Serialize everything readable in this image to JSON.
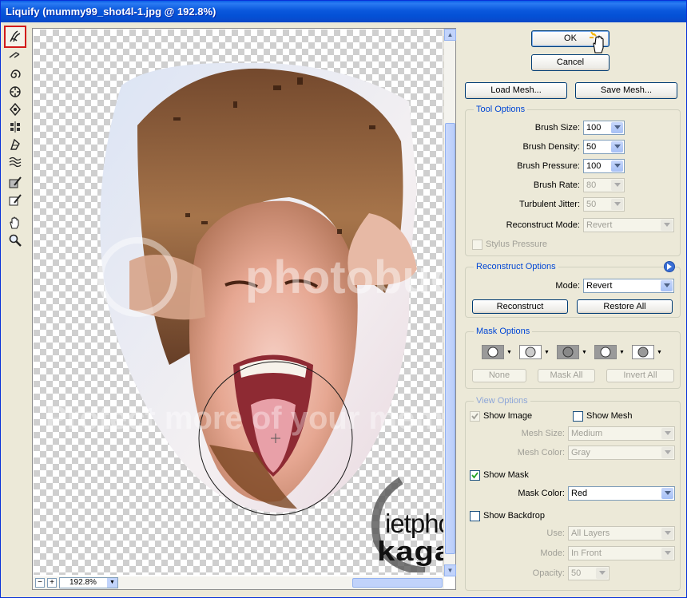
{
  "window": {
    "title": "Liquify (mummy99_shot4l-1.jpg @ 192.8%)"
  },
  "toolbar": {
    "tools": [
      {
        "name": "forward-warp-tool",
        "selected": true
      },
      {
        "name": "reconstruct-tool"
      },
      {
        "name": "twirl-clockwise-tool"
      },
      {
        "name": "pucker-tool"
      },
      {
        "name": "bloat-tool"
      },
      {
        "name": "push-left-tool"
      },
      {
        "name": "mirror-tool"
      },
      {
        "name": "turbulence-tool"
      },
      {
        "name": "freeze-mask-tool"
      },
      {
        "name": "thaw-mask-tool"
      },
      {
        "name": "hand-tool"
      },
      {
        "name": "zoom-tool"
      }
    ]
  },
  "canvas": {
    "zoom": "192.8%",
    "zoom_minus": "−",
    "zoom_plus": "+",
    "watermark_logo": "ietphotoshop",
    "watermark_logo_sub": "kagaya"
  },
  "buttons": {
    "ok": "OK",
    "cancel": "Cancel",
    "load_mesh": "Load Mesh...",
    "save_mesh": "Save Mesh..."
  },
  "tool_options": {
    "label": "Tool Options",
    "brush_size_label": "Brush Size:",
    "brush_size": "100",
    "brush_density_label": "Brush Density:",
    "brush_density": "50",
    "brush_pressure_label": "Brush Pressure:",
    "brush_pressure": "100",
    "brush_rate_label": "Brush Rate:",
    "brush_rate": "80",
    "turbulent_jitter_label": "Turbulent Jitter:",
    "turbulent_jitter": "50",
    "reconstruct_mode_label": "Reconstruct Mode:",
    "reconstruct_mode": "Revert",
    "stylus_pressure_label": "Stylus Pressure"
  },
  "reconstruct_options": {
    "label": "Reconstruct Options",
    "mode_label": "Mode:",
    "mode": "Revert",
    "reconstruct_button": "Reconstruct",
    "restore_all_button": "Restore All"
  },
  "mask_options": {
    "label": "Mask Options",
    "none_button": "None",
    "mask_all_button": "Mask All",
    "invert_all_button": "Invert All"
  },
  "view_options": {
    "label": "View Options",
    "show_image_label": "Show Image",
    "show_image": true,
    "show_mesh_label": "Show Mesh",
    "show_mesh": false,
    "mesh_size_label": "Mesh Size:",
    "mesh_size": "Medium",
    "mesh_color_label": "Mesh Color:",
    "mesh_color": "Gray",
    "show_mask_label": "Show Mask",
    "show_mask": true,
    "mask_color_label": "Mask Color:",
    "mask_color": "Red",
    "show_backdrop_label": "Show Backdrop",
    "show_backdrop": false,
    "use_label": "Use:",
    "use": "All Layers",
    "mode_label": "Mode:",
    "mode": "In Front",
    "opacity_label": "Opacity:",
    "opacity": "50"
  },
  "colors": {
    "titlebar": "#0a58dc",
    "panel_bg": "#ece9d8",
    "group_label": "#0046d5",
    "selected_tool_border": "#d21b1b"
  }
}
